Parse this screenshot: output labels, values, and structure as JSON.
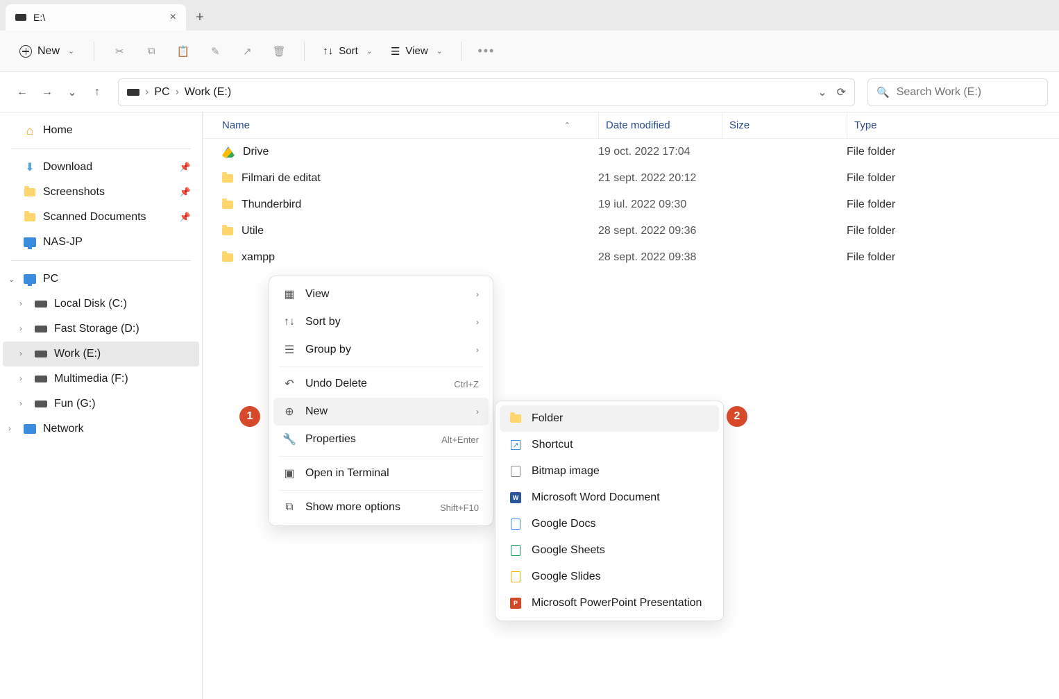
{
  "tab": {
    "title": "E:\\"
  },
  "toolbar": {
    "new_label": "New",
    "sort_label": "Sort",
    "view_label": "View"
  },
  "breadcrumbs": {
    "pc": "PC",
    "drive": "Work (E:)"
  },
  "search": {
    "placeholder": "Search Work (E:)"
  },
  "sidebar": {
    "home": "Home",
    "pinned": [
      {
        "label": "Download"
      },
      {
        "label": "Screenshots"
      },
      {
        "label": "Scanned Documents"
      },
      {
        "label": "NAS-JP"
      }
    ],
    "pc_label": "PC",
    "drives": [
      {
        "label": "Local Disk (C:)"
      },
      {
        "label": "Fast Storage (D:)"
      },
      {
        "label": "Work (E:)",
        "selected": true
      },
      {
        "label": "Multimedia (F:)"
      },
      {
        "label": "Fun (G:)"
      }
    ],
    "network": "Network"
  },
  "columns": {
    "name": "Name",
    "date": "Date modified",
    "size": "Size",
    "type": "Type"
  },
  "rows": [
    {
      "name": "Drive",
      "date": "19 oct. 2022 17:04",
      "type": "File folder",
      "icon": "gdrive"
    },
    {
      "name": "Filmari de editat",
      "date": "21 sept. 2022 20:12",
      "type": "File folder",
      "icon": "folder"
    },
    {
      "name": "Thunderbird",
      "date": "19 iul. 2022 09:30",
      "type": "File folder",
      "icon": "folder"
    },
    {
      "name": "Utile",
      "date": "28 sept. 2022 09:36",
      "type": "File folder",
      "icon": "folder"
    },
    {
      "name": "xampp",
      "date": "28 sept. 2022 09:38",
      "type": "File folder",
      "icon": "folder"
    }
  ],
  "context_menu": {
    "view": "View",
    "sort_by": "Sort by",
    "group_by": "Group by",
    "undo_delete": "Undo Delete",
    "undo_shortcut": "Ctrl+Z",
    "new": "New",
    "properties": "Properties",
    "properties_shortcut": "Alt+Enter",
    "open_terminal": "Open in Terminal",
    "show_more": "Show more options",
    "show_more_shortcut": "Shift+F10"
  },
  "new_submenu": {
    "folder": "Folder",
    "shortcut": "Shortcut",
    "bitmap": "Bitmap image",
    "word": "Microsoft Word Document",
    "gdocs": "Google Docs",
    "gsheets": "Google Sheets",
    "gslides": "Google Slides",
    "ppt": "Microsoft PowerPoint Presentation"
  },
  "annotations": {
    "one": "1",
    "two": "2"
  }
}
